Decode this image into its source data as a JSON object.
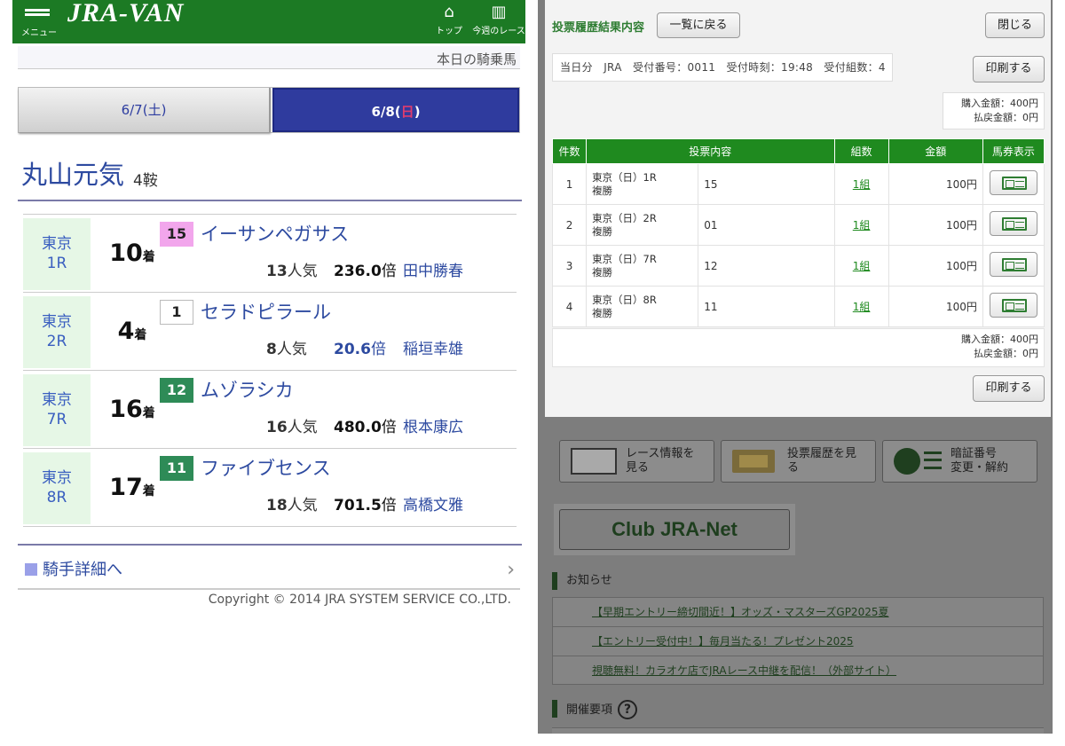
{
  "left": {
    "header": {
      "menu_label": "メニュー",
      "logo": "JRA-VAN",
      "nav_top": "トップ",
      "nav_week": "今週のレース"
    },
    "subtitle": "本日の騎乗馬",
    "tabs": [
      {
        "date": "6/7(",
        "dow": "土",
        "close": ")"
      },
      {
        "date": "6/8(",
        "dow": "日",
        "close": ")"
      }
    ],
    "jockey": {
      "name": "丸山元気",
      "rides": "4鞍"
    },
    "races": [
      {
        "venue": "東京",
        "race": "1R",
        "place": "10",
        "place_suffix": "着",
        "umaban": "15",
        "umaban_bg": "#f2a6ec",
        "umaban_fg": "#222222",
        "horse": "イーサンペガサス",
        "pop_num": "13",
        "pop_suffix": "人気",
        "odds": "236.0",
        "odds_color": "#111111",
        "odds_suffix": "倍",
        "jockey": "田中勝春"
      },
      {
        "venue": "東京",
        "race": "2R",
        "place": "4",
        "place_suffix": "着",
        "umaban": "1",
        "umaban_bg": "#ffffff",
        "umaban_fg": "#222222",
        "horse": "セラドピラール",
        "pop_num": "8",
        "pop_suffix": "人気",
        "odds": "20.6",
        "odds_color": "#2d4aa0",
        "odds_suffix": "倍",
        "jockey": "稲垣幸雄"
      },
      {
        "venue": "東京",
        "race": "7R",
        "place": "16",
        "place_suffix": "着",
        "umaban": "12",
        "umaban_bg": "#2e8b57",
        "umaban_fg": "#ffffff",
        "horse": "ムゾラシカ",
        "pop_num": "16",
        "pop_suffix": "人気",
        "odds": "480.0",
        "odds_color": "#111111",
        "odds_suffix": "倍",
        "jockey": "根本康広"
      },
      {
        "venue": "東京",
        "race": "8R",
        "place": "17",
        "place_suffix": "着",
        "umaban": "11",
        "umaban_bg": "#2e8b57",
        "umaban_fg": "#ffffff",
        "horse": "ファイブセンス",
        "pop_num": "18",
        "pop_suffix": "人気",
        "odds": "701.5",
        "odds_color": "#111111",
        "odds_suffix": "倍",
        "jockey": "高橋文雅"
      }
    ],
    "detail_link": "騎手詳細へ",
    "copyright": "Copyright © 2014 JRA SYSTEM SERVICE CO.,LTD."
  },
  "right": {
    "title": "投票履歴結果内容",
    "back_button": "一覧に戻る",
    "close_button": "閉じる",
    "info": "当日分　JRA　受付番号：0011　受付時刻：19:48　受付組数：4",
    "print_button": "印刷する",
    "purchase_amount": "購入金額：400円",
    "refund_amount": "払戻金額：0円",
    "table_headers": [
      "件数",
      "投票内容",
      "組数",
      "金額",
      "馬券表示"
    ],
    "bets": [
      {
        "no": "1",
        "race": "東京（日）1R",
        "type": "複勝",
        "selection": "15",
        "combos": "1組",
        "amount": "100円"
      },
      {
        "no": "2",
        "race": "東京（日）2R",
        "type": "複勝",
        "selection": "01",
        "combos": "1組",
        "amount": "100円"
      },
      {
        "no": "3",
        "race": "東京（日）7R",
        "type": "複勝",
        "selection": "12",
        "combos": "1組",
        "amount": "100円"
      },
      {
        "no": "4",
        "race": "東京（日）8R",
        "type": "複勝",
        "selection": "11",
        "combos": "1組",
        "amount": "100円"
      }
    ],
    "total_purchase": "購入金額：400円",
    "total_refund": "払戻金額：0円",
    "print_button_bottom": "印刷する",
    "menu_buttons": [
      {
        "line1": "レース情報を",
        "line2": "見る"
      },
      {
        "line1": "投票履歴を見",
        "line2": "る"
      },
      {
        "line1": "暗証番号",
        "line2": "変更・解約"
      }
    ],
    "club_logo": "Club JRA-Net",
    "news_heading": "お知らせ",
    "news": [
      "【早期エントリー締切間近！】オッズ・マスターズGP2025夏",
      "【エントリー受付中！】毎月当たる！プレゼント2025",
      "視聴無料！カラオケ店でJRAレース中継を配信！（外部サイト）"
    ],
    "schedule_heading": "開催要項"
  }
}
